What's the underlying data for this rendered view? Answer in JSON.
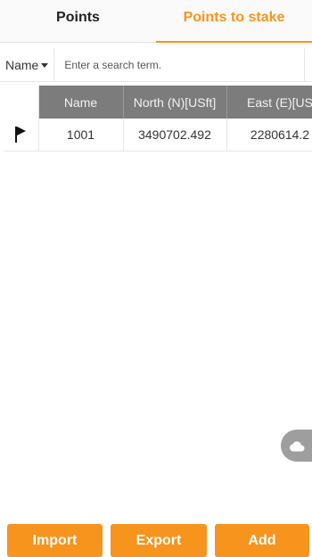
{
  "tabs": [
    {
      "label": "Points",
      "active": false
    },
    {
      "label": "Points to stake",
      "active": true
    }
  ],
  "search": {
    "field": "Name",
    "placeholder": "Enter a search term."
  },
  "table": {
    "columns": [
      "Name",
      "North (N)[USft]",
      "East (E)[US"
    ],
    "rows": [
      {
        "name": "1001",
        "north": "3490702.492",
        "east": "2280614.2"
      }
    ]
  },
  "buttons": {
    "import": "Import",
    "export": "Export",
    "add": "Add"
  },
  "icons": {
    "row_marker": "flag-icon",
    "fab": "cloud-icon"
  },
  "colors": {
    "accent": "#f7941d",
    "header_bg": "#7c7c7c"
  }
}
